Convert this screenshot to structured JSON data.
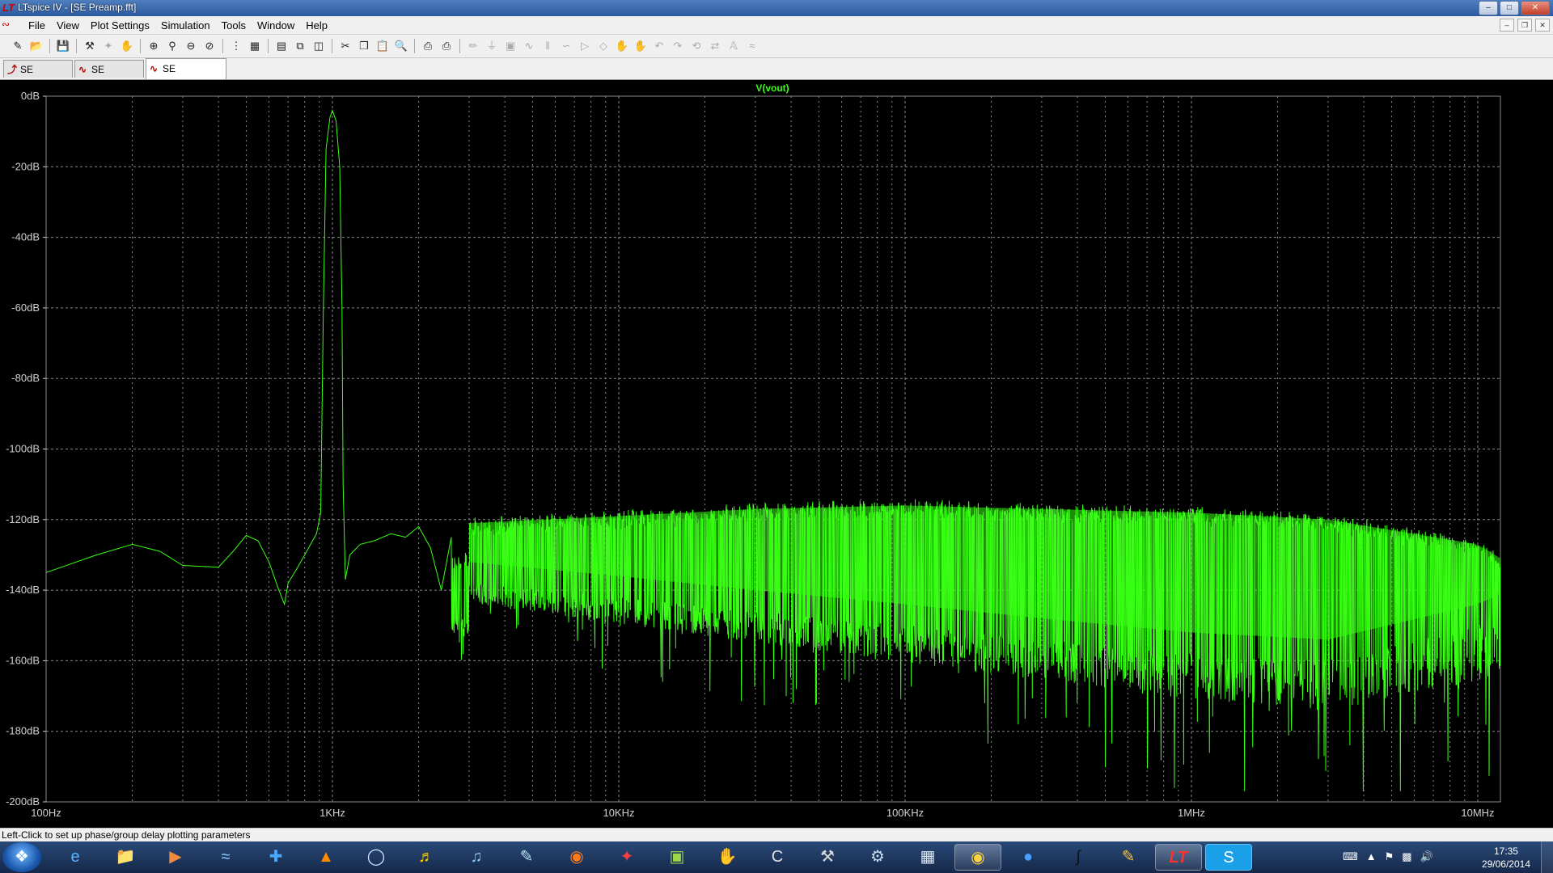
{
  "window": {
    "title": "LTspice IV - [SE Preamp.fft]"
  },
  "menu": [
    "File",
    "View",
    "Plot Settings",
    "Simulation",
    "Tools",
    "Window",
    "Help"
  ],
  "tabs": [
    {
      "label": "SE Preamp",
      "active": false
    },
    {
      "label": "SE Preamp",
      "active": false
    },
    {
      "label": "SE Preamp.fft",
      "active": true
    }
  ],
  "status": {
    "text": "Left-Click to set up phase/group delay plotting parameters"
  },
  "clock": {
    "time": "17:35",
    "date": "29/06/2014"
  },
  "colors": {
    "trace": "#39ff14",
    "plot_bg": "#000000",
    "grid": "#8a8a8a"
  },
  "chart_data": {
    "type": "line",
    "series": [
      {
        "name": "V(vout)",
        "color": "#39ff14",
        "points": [
          [
            100,
            -135
          ],
          [
            150,
            -130
          ],
          [
            200,
            -127
          ],
          [
            250,
            -129
          ],
          [
            300,
            -133
          ],
          [
            400,
            -133.5
          ],
          [
            450,
            -129
          ],
          [
            500,
            -124.5
          ],
          [
            550,
            -126
          ],
          [
            600,
            -132
          ],
          [
            650,
            -140
          ],
          [
            680,
            -144
          ],
          [
            700,
            -138
          ],
          [
            750,
            -134
          ],
          [
            800,
            -130
          ],
          [
            880,
            -124
          ],
          [
            910,
            -118
          ],
          [
            930,
            -60
          ],
          [
            950,
            -15
          ],
          [
            980,
            -6
          ],
          [
            1000,
            -4
          ],
          [
            1030,
            -7
          ],
          [
            1060,
            -20
          ],
          [
            1080,
            -60
          ],
          [
            1090,
            -110
          ],
          [
            1110,
            -137
          ],
          [
            1150,
            -130
          ],
          [
            1250,
            -127
          ],
          [
            1400,
            -126
          ],
          [
            1600,
            -124
          ],
          [
            1800,
            -125
          ],
          [
            2000,
            -122
          ],
          [
            2200,
            -128
          ],
          [
            2400,
            -140
          ],
          [
            2600,
            -125
          ]
        ],
        "noise_band": [
          {
            "x": 3000,
            "top": -123,
            "bottom": -138
          },
          {
            "x": 10000,
            "top": -121,
            "bottom": -142
          },
          {
            "x": 30000,
            "top": -119,
            "bottom": -146
          },
          {
            "x": 100000,
            "top": -118,
            "bottom": -150
          },
          {
            "x": 300000,
            "top": -119,
            "bottom": -154
          },
          {
            "x": 1000000,
            "top": -120,
            "bottom": -158
          },
          {
            "x": 3000000,
            "top": -122,
            "bottom": -160
          },
          {
            "x": 10000000,
            "top": -129,
            "bottom": -150
          },
          {
            "x": 12000000,
            "top": -133,
            "bottom": -147
          }
        ]
      }
    ],
    "x_ticks": [
      "100Hz",
      "1KHz",
      "10KHz",
      "100KHz",
      "1MHz",
      "10MHz"
    ],
    "y_ticks": [
      "0dB",
      "-20dB",
      "-40dB",
      "-60dB",
      "-80dB",
      "-100dB",
      "-120dB",
      "-140dB",
      "-160dB",
      "-180dB",
      "-200dB"
    ],
    "xlim": [
      100,
      12000000
    ],
    "ylim": [
      -200,
      0
    ],
    "x_scale": "log",
    "grid": true
  }
}
